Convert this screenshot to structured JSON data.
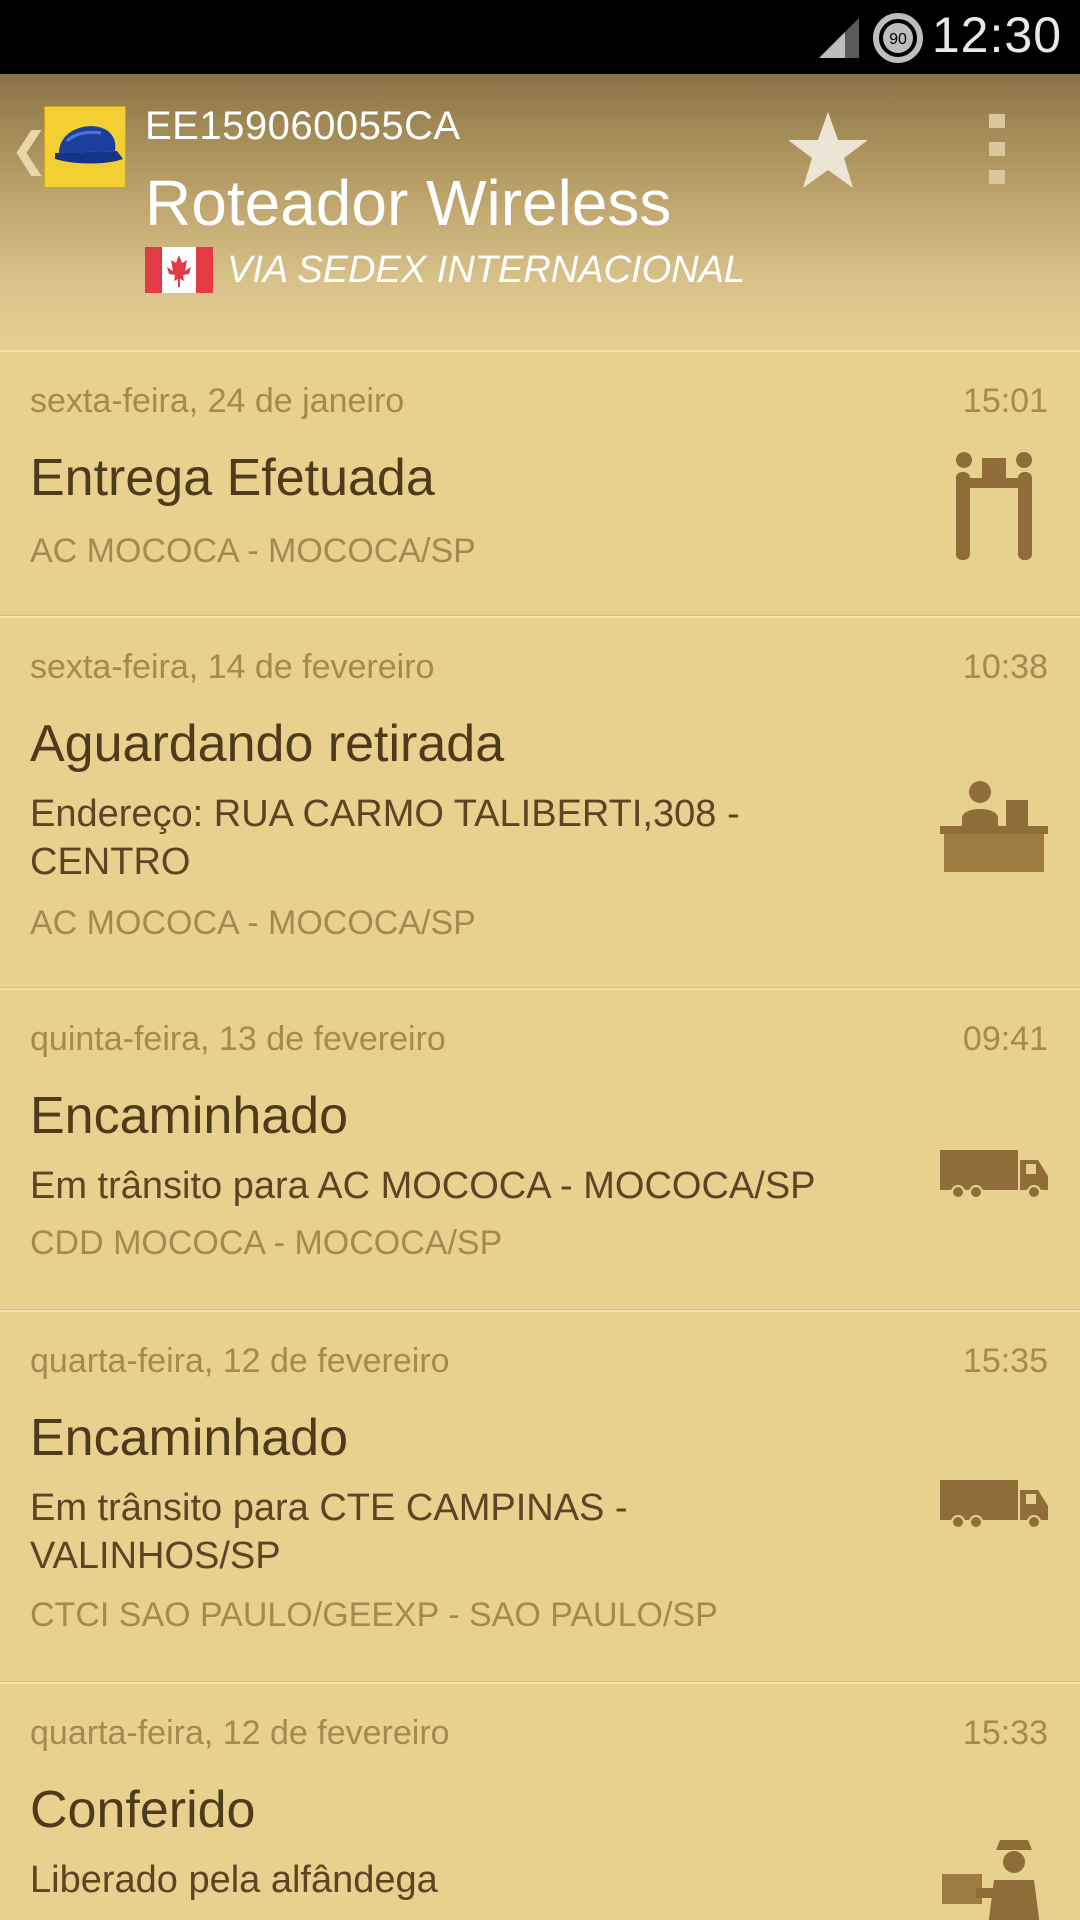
{
  "status_bar": {
    "time": "12:30",
    "battery_level": "90",
    "signal_icon": "cell-signal-icon"
  },
  "header": {
    "back_icon": "chevron-left-icon",
    "logo_icon": "mail-cap-logo-icon",
    "tracking_code": "EE159060055CA",
    "item_title": "Roteador Wireless",
    "flag_icon": "canada-flag-icon",
    "service": "VIA SEDEX INTERNACIONAL",
    "star_icon": "star-icon",
    "overflow_icon": "overflow-menu-icon"
  },
  "events": [
    {
      "date": "sexta-feira, 24 de janeiro",
      "time": "15:01",
      "status": "Entrega Efetuada",
      "detail": "",
      "location": "AC MOCOCA - MOCOCA/SP",
      "icon": "delivery-handover-icon"
    },
    {
      "date": "sexta-feira, 14 de fevereiro",
      "time": "10:38",
      "status": "Aguardando retirada",
      "detail": "Endereço: RUA CARMO TALIBERTI,308 - CENTRO",
      "location": "AC MOCOCA - MOCOCA/SP",
      "icon": "counter-clerk-icon"
    },
    {
      "date": "quinta-feira, 13 de fevereiro",
      "time": "09:41",
      "status": "Encaminhado",
      "detail": "Em trânsito para AC MOCOCA - MOCOCA/SP",
      "location": "CDD MOCOCA - MOCOCA/SP",
      "icon": "truck-icon"
    },
    {
      "date": "quarta-feira, 12 de fevereiro",
      "time": "15:35",
      "status": "Encaminhado",
      "detail": "Em trânsito para CTE CAMPINAS - VALINHOS/SP",
      "location": "CTCI SAO PAULO/GEEXP - SAO PAULO/SP",
      "icon": "truck-icon"
    },
    {
      "date": "quarta-feira, 12 de fevereiro",
      "time": "15:33",
      "status": "Conferido",
      "detail": "Liberado pela alfândega",
      "location": "",
      "icon": "customs-officer-icon"
    }
  ],
  "colors": {
    "background": "#e8d08f",
    "header_top": "#8a7446",
    "accent_text": "#a88850",
    "primary_text": "#4d3c1c",
    "icon_brown": "#8f6d38",
    "logo_yellow": "#f3cf34"
  }
}
